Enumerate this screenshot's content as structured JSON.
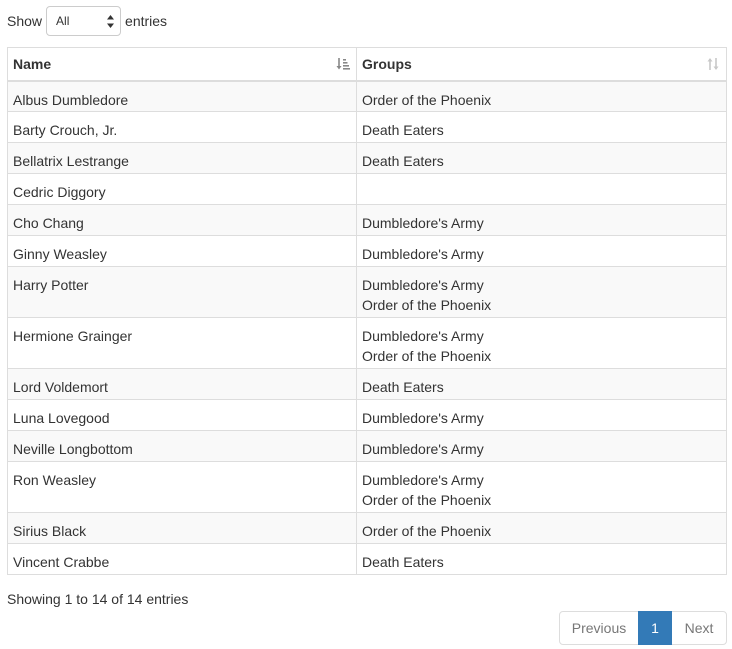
{
  "length_menu": {
    "prefix": "Show",
    "selected": "All",
    "suffix": "entries"
  },
  "table": {
    "columns": [
      {
        "label": "Name",
        "sort": "ascending"
      },
      {
        "label": "Groups",
        "sort": "none"
      }
    ],
    "rows": [
      {
        "name": "Albus Dumbledore",
        "groups": [
          "Order of the Phoenix"
        ]
      },
      {
        "name": "Barty Crouch, Jr.",
        "groups": [
          "Death Eaters"
        ]
      },
      {
        "name": "Bellatrix Lestrange",
        "groups": [
          "Death Eaters"
        ]
      },
      {
        "name": "Cedric Diggory",
        "groups": []
      },
      {
        "name": "Cho Chang",
        "groups": [
          "Dumbledore's Army"
        ]
      },
      {
        "name": "Ginny Weasley",
        "groups": [
          "Dumbledore's Army"
        ]
      },
      {
        "name": "Harry Potter",
        "groups": [
          "Dumbledore's Army",
          "Order of the Phoenix"
        ]
      },
      {
        "name": "Hermione Grainger",
        "groups": [
          "Dumbledore's Army",
          "Order of the Phoenix"
        ]
      },
      {
        "name": "Lord Voldemort",
        "groups": [
          "Death Eaters"
        ]
      },
      {
        "name": "Luna Lovegood",
        "groups": [
          "Dumbledore's Army"
        ]
      },
      {
        "name": "Neville Longbottom",
        "groups": [
          "Dumbledore's Army"
        ]
      },
      {
        "name": "Ron Weasley",
        "groups": [
          "Dumbledore's Army",
          "Order of the Phoenix"
        ]
      },
      {
        "name": "Sirius Black",
        "groups": [
          "Order of the Phoenix"
        ]
      },
      {
        "name": "Vincent Crabbe",
        "groups": [
          "Death Eaters"
        ]
      }
    ]
  },
  "info": "Showing 1 to 14 of 14 entries",
  "pagination": {
    "previous": "Previous",
    "current": "1",
    "next": "Next"
  },
  "colors": {
    "accent": "#337ab7",
    "stripe": "#f9f9f9",
    "border": "#dddddd"
  },
  "icons": {
    "name_sort": "sort-ascending-icon",
    "groups_sort": "sort-both-icon",
    "select": "select-arrows-icon"
  }
}
